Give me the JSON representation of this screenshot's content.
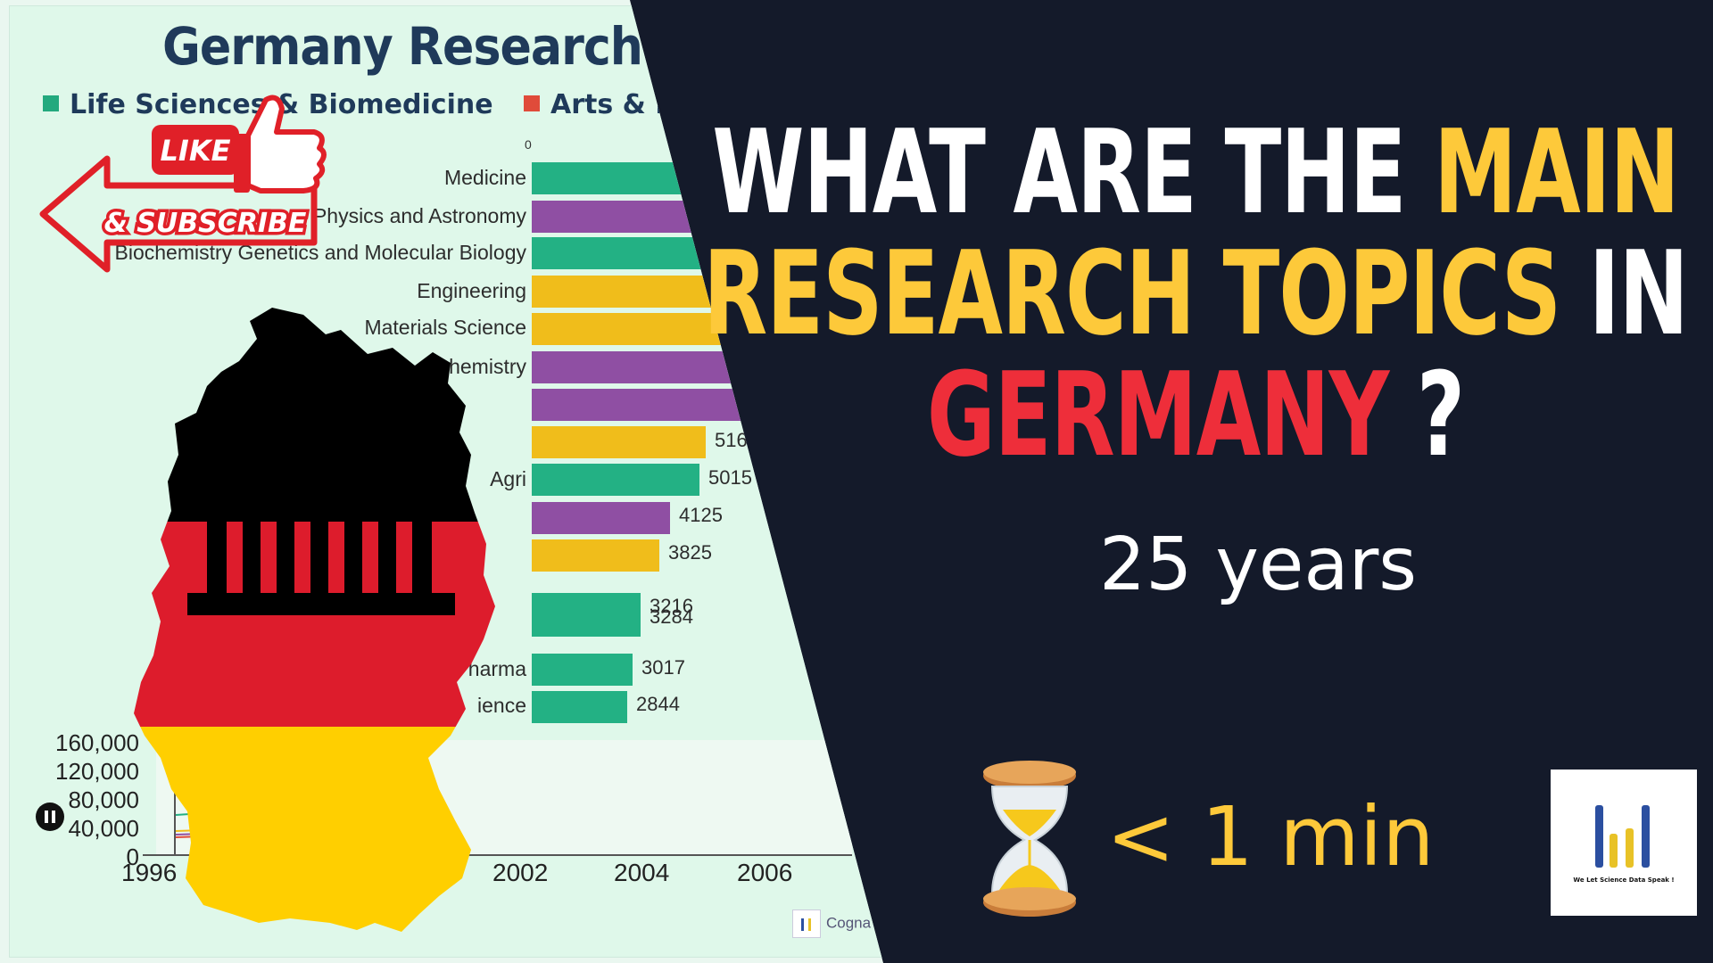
{
  "chart": {
    "title": "Germany Research",
    "legend": [
      {
        "label": "Life Sciences & Biomedicine",
        "color": "#23a97e"
      },
      {
        "label": "Arts & H",
        "color": "#e04b3a"
      }
    ],
    "zero_tick": "0",
    "rows": [
      {
        "label": "Medicine",
        "color": "#23b184",
        "value": ""
      },
      {
        "label": "Physics and Astronomy",
        "color": "#8f4fa3",
        "value": ""
      },
      {
        "label": "Biochemistry Genetics and Molecular Biology",
        "color": "#23b184",
        "value": ""
      },
      {
        "label": "Engineering",
        "color": "#f0bd1b",
        "value": ""
      },
      {
        "label": "Materials Science",
        "color": "#f0bd1b",
        "value": ""
      },
      {
        "label": "Chemistry",
        "color": "#8f4fa3",
        "value": ""
      },
      {
        "label": "",
        "color": "#8f4fa3",
        "value": ""
      },
      {
        "label": "",
        "color": "#f0bd1b",
        "value": "516"
      },
      {
        "label": "Agri",
        "color": "#23b184",
        "value": "5015"
      },
      {
        "label": "",
        "color": "#8f4fa3",
        "value": "4125"
      },
      {
        "label": "",
        "color": "#f0bd1b",
        "value": "3825"
      },
      {
        "label": "",
        "color": "#23b184",
        "value": "3216"
      },
      {
        "label": "",
        "color": "#23b184",
        "value": "3284"
      },
      {
        "label": "Pharma",
        "color": "#23b184",
        "value": "3017"
      },
      {
        "label": "ience",
        "color": "#23b184",
        "value": "2844"
      }
    ],
    "y_ticks": [
      "160,000",
      "120,000",
      "80,000",
      "40,000",
      "0"
    ],
    "x_ticks": [
      "1996",
      "2002",
      "2004",
      "2006"
    ],
    "credit": "Cogna"
  },
  "badges": {
    "like": "LIKE",
    "subscribe": "& SUBSCRIBE"
  },
  "headline": {
    "line1_a": "WHAT ARE THE ",
    "line1_b": "MAIN",
    "line2_a": "RESEARCH TOPICS",
    "line2_b": " IN",
    "line3_a": "GERMANY",
    "line3_b": " ?",
    "years": "25 years",
    "time": "< 1 min"
  },
  "logo": {
    "tagline": "We Let Science Data Speak !"
  },
  "colors": {
    "background": "#141a2a",
    "accent_yellow": "#fdc93a",
    "accent_red": "#ee2e3a",
    "flag_black": "#000000",
    "flag_red": "#dd1c2c",
    "flag_gold": "#ffcf00"
  },
  "icons": [
    "pause-icon",
    "thumbs-up-icon",
    "arrow-left-icon",
    "hourglass-icon",
    "germany-map-icon",
    "brandenburg-gate-icon"
  ]
}
